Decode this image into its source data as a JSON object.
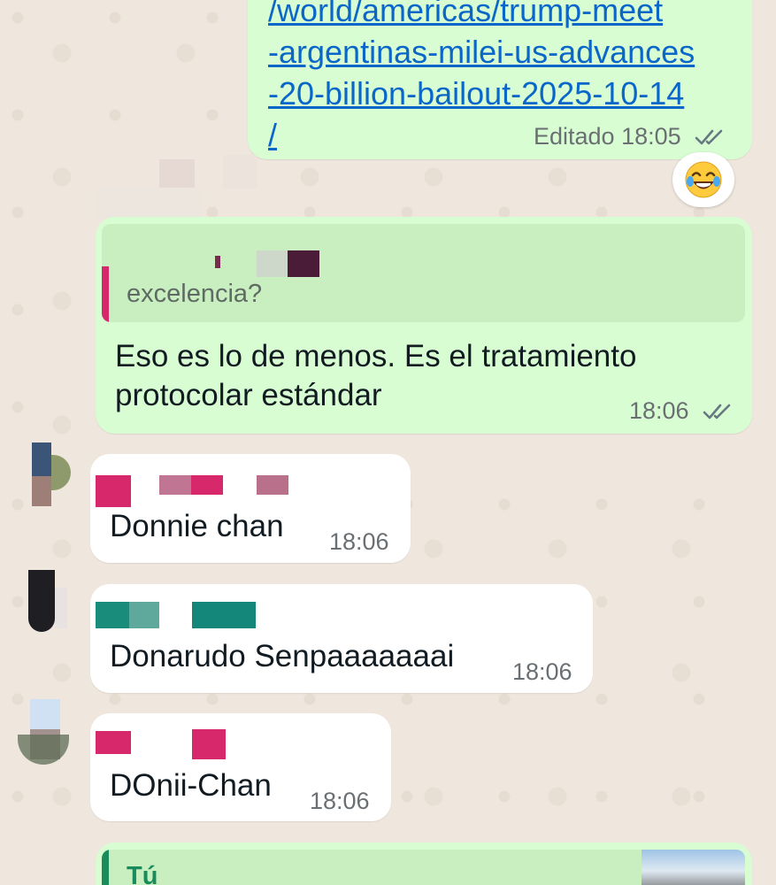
{
  "messages": [
    {
      "type": "outgoing-link",
      "link_lines": [
        "/world/americas/trump-meet",
        "-argentinas-milei-us-advances",
        "-20-billion-bailout-2025-10-14",
        "/"
      ],
      "edited_label": "Editado",
      "time": "18:05",
      "status": "read",
      "reaction": "😂"
    },
    {
      "type": "outgoing-reply",
      "quoted_text": "excelencia?",
      "text_lines": [
        "Eso es lo de menos. Es el tratamiento",
        "protocolar estándar"
      ],
      "time": "18:06",
      "status": "read"
    },
    {
      "type": "incoming",
      "text": "Donnie chan",
      "time": "18:06"
    },
    {
      "type": "incoming",
      "text": "Donarudo Senpaaaaaaai",
      "time": "18:06"
    },
    {
      "type": "incoming",
      "text": "DOnii-Chan",
      "time": "18:06"
    },
    {
      "type": "outgoing-reply",
      "quoted_sender": "Tú"
    }
  ],
  "colors": {
    "outgoing_bubble": "#d8fdd2",
    "incoming_bubble": "#ffffff",
    "link": "#0a66c9",
    "read_ticks": "#667781",
    "quote_bar": "#d6286a",
    "chat_background": "#efe7dd"
  }
}
